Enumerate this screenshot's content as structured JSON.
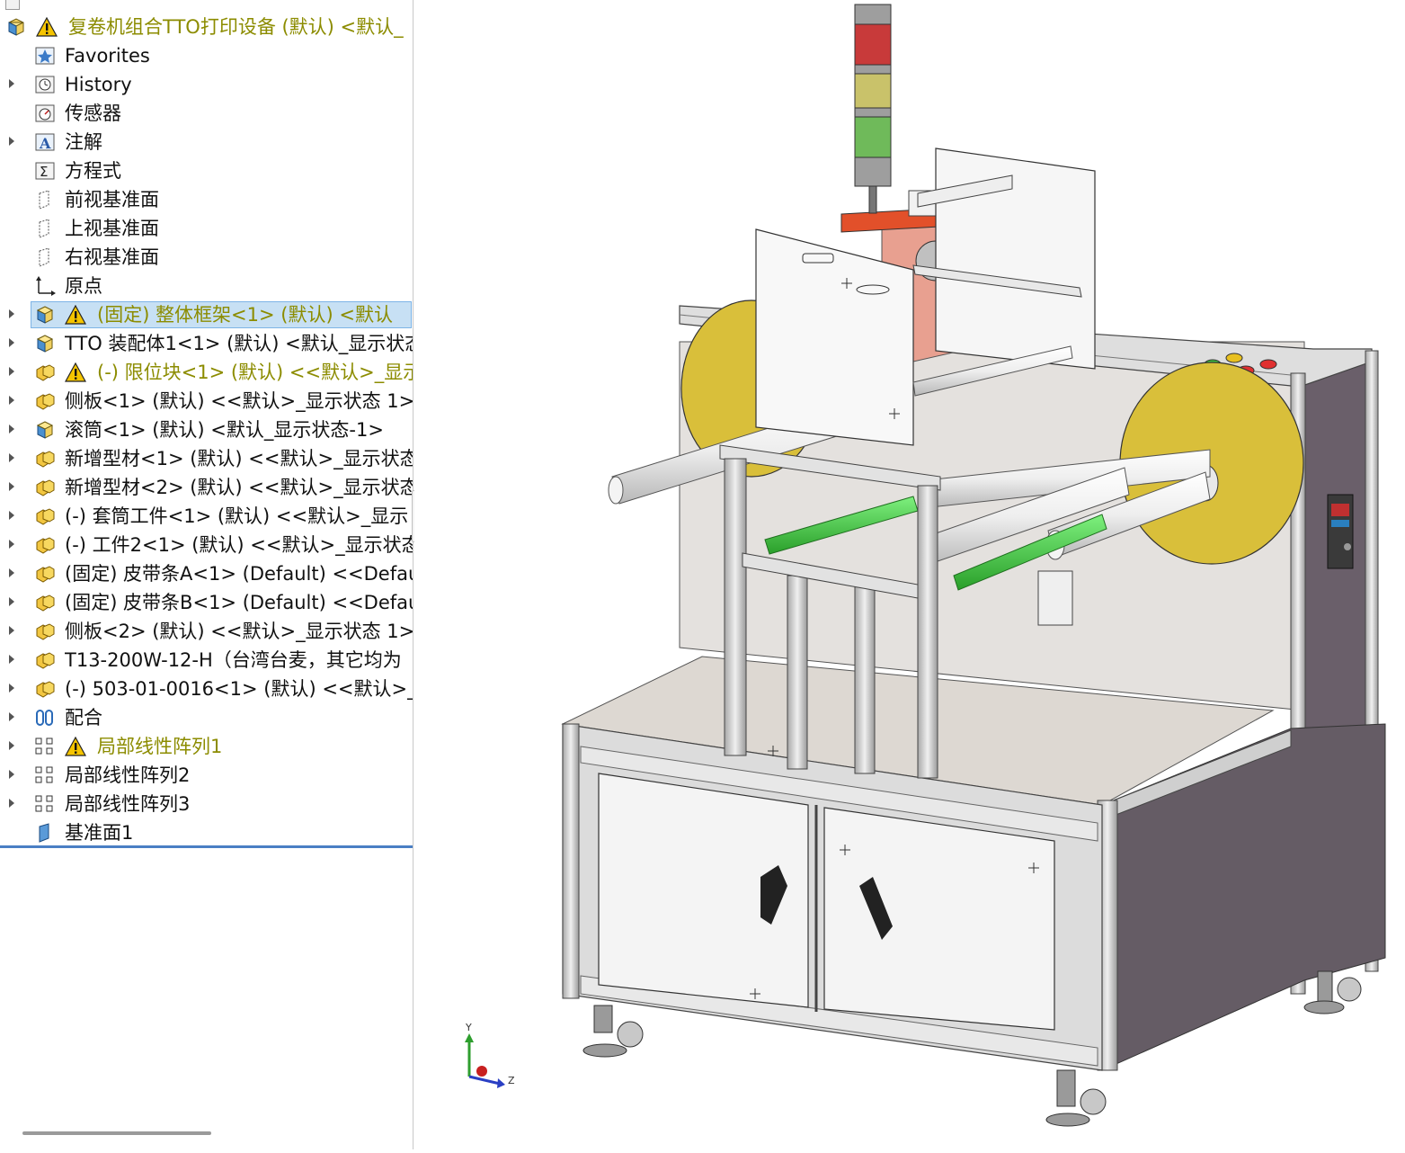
{
  "feature_tree": {
    "items": [
      {
        "label": "复卷机组合TTO打印设备 (默认) <默认_",
        "icon": "assembly-icon",
        "warning": true,
        "expander": false,
        "olive": true,
        "indent": 0
      },
      {
        "label": "Favorites",
        "icon": "favorites-icon",
        "warning": false,
        "expander": false,
        "olive": false,
        "indent": 1
      },
      {
        "label": "History",
        "icon": "history-icon",
        "warning": false,
        "expander": true,
        "olive": false,
        "indent": 1
      },
      {
        "label": "传感器",
        "icon": "sensor-icon",
        "warning": false,
        "expander": false,
        "olive": false,
        "indent": 1
      },
      {
        "label": "注解",
        "icon": "annotation-icon",
        "warning": false,
        "expander": true,
        "olive": false,
        "indent": 1
      },
      {
        "label": "方程式",
        "icon": "equation-icon",
        "warning": false,
        "expander": false,
        "olive": false,
        "indent": 1
      },
      {
        "label": "前视基准面",
        "icon": "plane-icon",
        "warning": false,
        "expander": false,
        "olive": false,
        "indent": 1
      },
      {
        "label": "上视基准面",
        "icon": "plane-icon",
        "warning": false,
        "expander": false,
        "olive": false,
        "indent": 1
      },
      {
        "label": "右视基准面",
        "icon": "plane-icon",
        "warning": false,
        "expander": false,
        "olive": false,
        "indent": 1
      },
      {
        "label": "原点",
        "icon": "origin-icon",
        "warning": false,
        "expander": false,
        "olive": false,
        "indent": 1
      },
      {
        "label": "(固定) 整体框架<1> (默认) <默认",
        "icon": "subassembly-icon",
        "warning": true,
        "expander": true,
        "olive": true,
        "selected": true,
        "indent": 1
      },
      {
        "label": "TTO 装配体1<1> (默认) <默认_显示状态",
        "icon": "subassembly-icon",
        "warning": false,
        "expander": true,
        "olive": false,
        "indent": 1
      },
      {
        "label": "(-) 限位块<1> (默认) <<默认>_显示",
        "icon": "part-icon",
        "warning": true,
        "expander": true,
        "olive": true,
        "indent": 1
      },
      {
        "label": "侧板<1> (默认) <<默认>_显示状态 1>",
        "icon": "part-icon",
        "warning": false,
        "expander": true,
        "olive": false,
        "indent": 1
      },
      {
        "label": "滚筒<1> (默认) <默认_显示状态-1>",
        "icon": "subassembly-icon",
        "warning": false,
        "expander": true,
        "olive": false,
        "indent": 1
      },
      {
        "label": "新增型材<1> (默认) <<默认>_显示状态",
        "icon": "part-icon",
        "warning": false,
        "expander": true,
        "olive": false,
        "indent": 1
      },
      {
        "label": "新增型材<2> (默认) <<默认>_显示状态",
        "icon": "part-icon",
        "warning": false,
        "expander": true,
        "olive": false,
        "indent": 1
      },
      {
        "label": "(-) 套筒工件<1> (默认) <<默认>_显示",
        "icon": "part-icon",
        "warning": false,
        "expander": true,
        "olive": false,
        "indent": 1
      },
      {
        "label": "(-) 工件2<1> (默认) <<默认>_显示状态",
        "icon": "part-icon",
        "warning": false,
        "expander": true,
        "olive": false,
        "indent": 1
      },
      {
        "label": "(固定) 皮带条A<1> (Default) <<Defau",
        "icon": "part-icon",
        "warning": false,
        "expander": true,
        "olive": false,
        "indent": 1
      },
      {
        "label": "(固定) 皮带条B<1> (Default) <<Defau",
        "icon": "part-icon",
        "warning": false,
        "expander": true,
        "olive": false,
        "indent": 1
      },
      {
        "label": "侧板<2> (默认) <<默认>_显示状态 1>",
        "icon": "part-icon",
        "warning": false,
        "expander": true,
        "olive": false,
        "indent": 1
      },
      {
        "label": "T13-200W-12-H（台湾台麦，其它均为",
        "icon": "part-icon",
        "warning": false,
        "expander": true,
        "olive": false,
        "indent": 1
      },
      {
        "label": "(-) 503-01-0016<1> (默认) <<默认>_",
        "icon": "part-icon",
        "warning": false,
        "expander": true,
        "olive": false,
        "indent": 1
      },
      {
        "label": "配合",
        "icon": "mates-icon",
        "warning": false,
        "expander": true,
        "olive": false,
        "indent": 1
      },
      {
        "label": "局部线性阵列1",
        "icon": "pattern-icon",
        "warning": true,
        "expander": true,
        "olive": true,
        "indent": 1
      },
      {
        "label": "局部线性阵列2",
        "icon": "pattern-icon",
        "warning": false,
        "expander": true,
        "olive": false,
        "indent": 1
      },
      {
        "label": "局部线性阵列3",
        "icon": "pattern-icon",
        "warning": false,
        "expander": true,
        "olive": false,
        "indent": 1
      },
      {
        "label": "基准面1",
        "icon": "plane-solid-icon",
        "warning": false,
        "expander": false,
        "olive": false,
        "indent": 1
      }
    ]
  },
  "triad": {
    "y_label": "Y",
    "z_label": "Z"
  },
  "colors": {
    "selection": "#c7e0f4",
    "olive_text": "#8c8c00",
    "warning_yellow": "#f5c400",
    "frame_gray": "#d9d9d9",
    "panel_dark": "#6a5f6a",
    "reel_yellow": "#d9bf3a",
    "printer_orange": "#e2502a",
    "belt_green": "#3fbf3f"
  }
}
